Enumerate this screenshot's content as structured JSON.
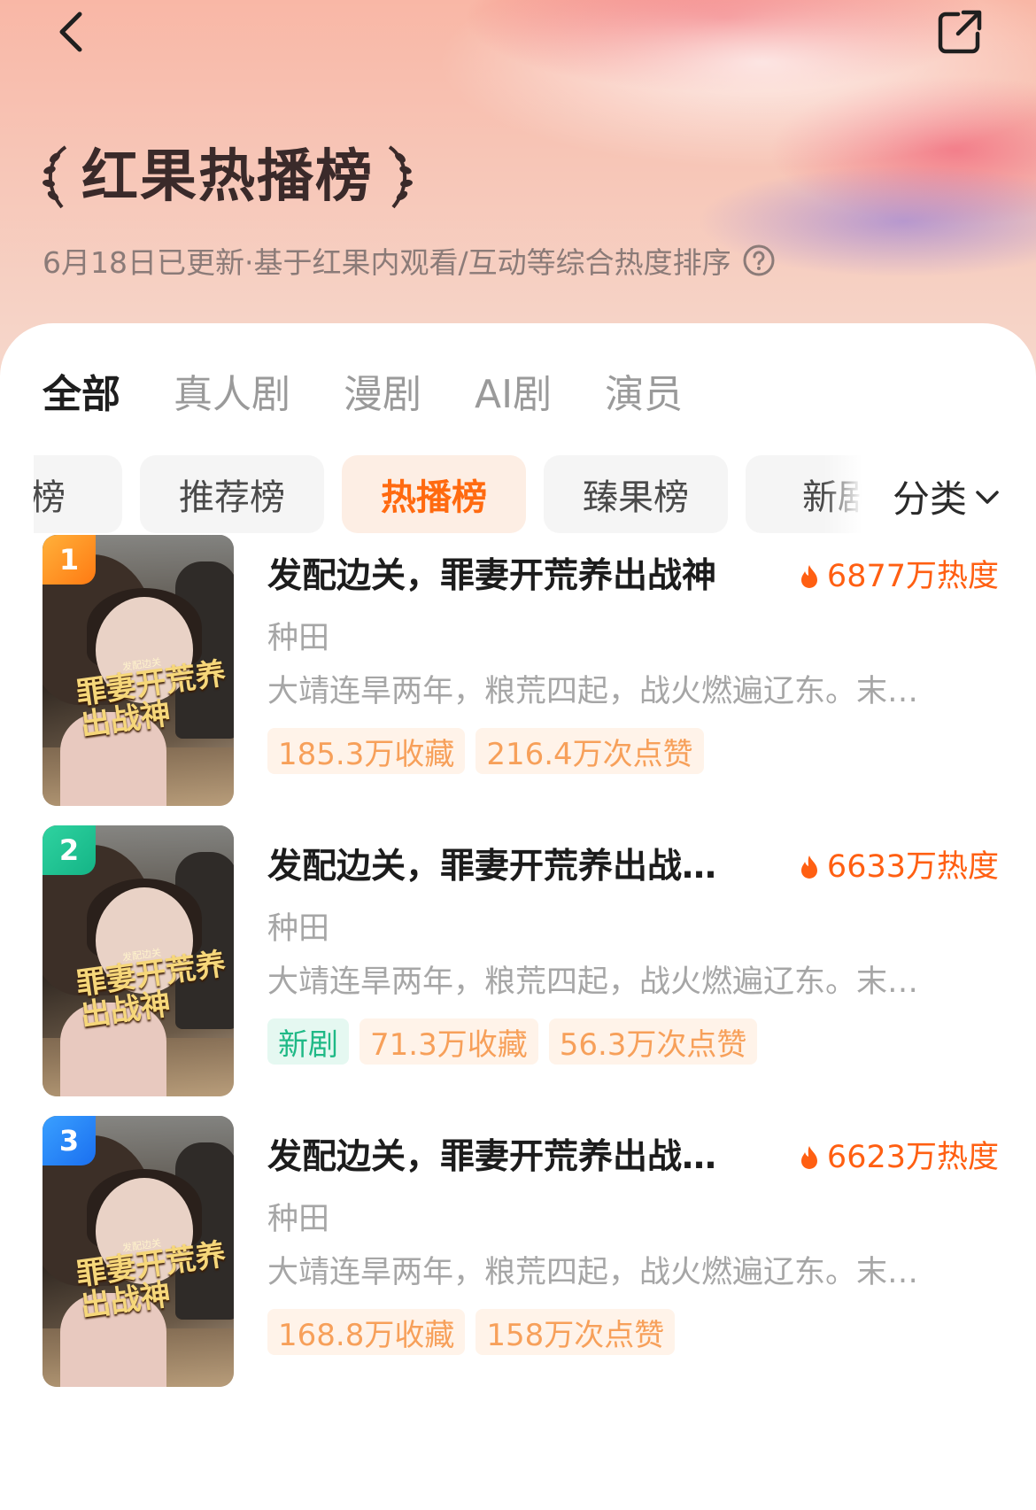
{
  "header": {
    "title": "红果热播榜",
    "subtitle": "6月18日已更新·基于红果内观看/互动等综合热度排序"
  },
  "tabs": [
    {
      "label": "全部",
      "active": true
    },
    {
      "label": "真人剧",
      "active": false
    },
    {
      "label": "漫剧",
      "active": false
    },
    {
      "label": "AI剧",
      "active": false
    },
    {
      "label": "演员",
      "active": false
    }
  ],
  "chips": [
    {
      "label": "的榜",
      "active": false
    },
    {
      "label": "推荐榜",
      "active": false
    },
    {
      "label": "热播榜",
      "active": true
    },
    {
      "label": "臻果榜",
      "active": false
    },
    {
      "label": "新剧",
      "active": false
    }
  ],
  "category_label": "分类",
  "cover": {
    "title": "罪妻开荒养出战神",
    "small": "发配边关"
  },
  "items": [
    {
      "rank": "1",
      "name": "发配边关，罪妻开荒养出战神",
      "heat": "6877万热度",
      "genre": "种田",
      "desc": "大靖连旱两年，粮荒四起，战火燃遍辽东。末世…",
      "tags": [
        {
          "label": "185.3万收藏",
          "type": "stat"
        },
        {
          "label": "216.4万次点赞",
          "type": "stat"
        }
      ]
    },
    {
      "rank": "2",
      "name": "发配边关，罪妻开荒养出战…",
      "heat": "6633万热度",
      "genre": "种田",
      "desc": "大靖连旱两年，粮荒四起，战火燃遍辽东。末世…",
      "tags": [
        {
          "label": "新剧",
          "type": "new"
        },
        {
          "label": "71.3万收藏",
          "type": "stat"
        },
        {
          "label": "56.3万次点赞",
          "type": "stat"
        }
      ]
    },
    {
      "rank": "3",
      "name": "发配边关，罪妻开荒养出战…",
      "heat": "6623万热度",
      "genre": "种田",
      "desc": "大靖连旱两年，粮荒四起，战火燃遍辽东。末世…",
      "tags": [
        {
          "label": "168.8万收藏",
          "type": "stat"
        },
        {
          "label": "158万次点赞",
          "type": "stat"
        }
      ]
    }
  ],
  "colors": {
    "accent": "#ff5f12",
    "rank1": "#ff8a1a",
    "rank2": "#1fc492",
    "rank3": "#2a86ff"
  },
  "icons": [
    "back-icon",
    "share-icon",
    "laurel-icon",
    "help-icon",
    "chevron-down-icon",
    "fire-icon"
  ]
}
